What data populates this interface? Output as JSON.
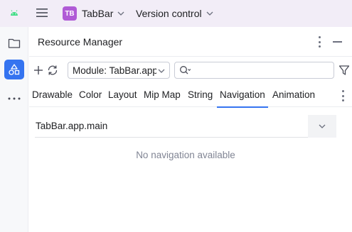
{
  "titlebar": {
    "project_badge": "TB",
    "project_name": "TabBar",
    "vcs_label": "Version control",
    "badge_color": "#b05bd6",
    "background": "#f2edf7"
  },
  "toolstrip": {
    "items": [
      {
        "icon": "folder-icon",
        "active": false
      },
      {
        "icon": "resource-manager-icon",
        "active": true
      },
      {
        "icon": "more-horizontal-icon",
        "active": false
      }
    ],
    "accent": "#3574f0"
  },
  "panel": {
    "title": "Resource Manager"
  },
  "toolbar": {
    "module_value": "Module: TabBar.app",
    "search_value": "",
    "search_placeholder": ""
  },
  "tabs": [
    {
      "label": "Drawable",
      "selected": false
    },
    {
      "label": "Color",
      "selected": false
    },
    {
      "label": "Layout",
      "selected": false
    },
    {
      "label": "Mip Map",
      "selected": false
    },
    {
      "label": "String",
      "selected": false
    },
    {
      "label": "Navigation",
      "selected": true
    },
    {
      "label": "Animation",
      "selected": false
    }
  ],
  "directory": {
    "label": "TabBar.app.main"
  },
  "empty_message": "No navigation available"
}
